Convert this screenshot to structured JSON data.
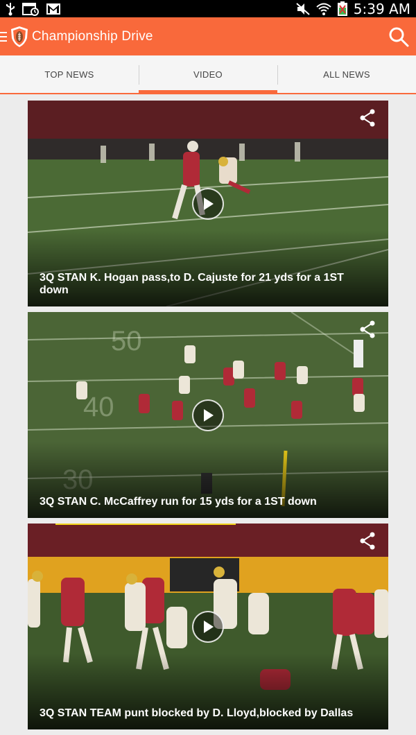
{
  "status_bar": {
    "time": "5:39 AM",
    "icons": [
      "usb-icon",
      "calendar-icon",
      "gmail-icon",
      "mute-icon",
      "wifi-icon",
      "battery-icon"
    ]
  },
  "app_bar": {
    "title": "Championship Drive",
    "icons": [
      "menu-icon",
      "shield-logo",
      "search-icon"
    ],
    "accent": "#f9693b"
  },
  "tabs": [
    {
      "label": "TOP NEWS",
      "active": false
    },
    {
      "label": "VIDEO",
      "active": true
    },
    {
      "label": "ALL NEWS",
      "active": false
    }
  ],
  "videos": [
    {
      "caption": "3Q STAN K. Hogan pass,to D. Cajuste for 21 yds for a 1ST down"
    },
    {
      "caption": "3Q STAN C. McCaffrey run for 15 yds for a 1ST down"
    },
    {
      "caption": "3Q STAN TEAM punt blocked by D. Lloyd,blocked by Dallas"
    }
  ]
}
